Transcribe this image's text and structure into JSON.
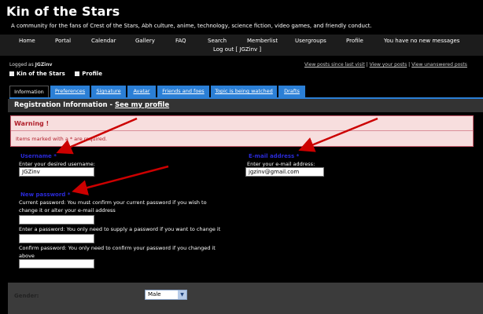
{
  "site": {
    "title": "Kin of the Stars",
    "description": "A community for the fans of Crest of the Stars, Abh culture, anime, technology, science fiction, video games, and friendly conduct."
  },
  "nav": {
    "home": "Home",
    "portal": "Portal",
    "calendar": "Calendar",
    "gallery": "Gallery",
    "faq": "FAQ",
    "search": "Search",
    "memberlist": "Memberlist",
    "usergroups": "Usergroups",
    "profile": "Profile",
    "messages": "You have no new messages",
    "logout": "Log out [ JGZinv ]"
  },
  "userbar": {
    "logged_as_prefix": "Logged as",
    "logged_as_user": "JGZinv",
    "posts_since_last_visit": "View posts since last visit",
    "your_posts": "View your posts",
    "unanswered_posts": "View unanswered posts",
    "separator": "|"
  },
  "breadcrumb": {
    "home": "Kin of the Stars",
    "profile": "Profile"
  },
  "tabs": {
    "information": "Information",
    "preferences": "Preferences",
    "signature": "Signature",
    "avatar": "Avatar",
    "friends": "Friends and foes",
    "watched": "Topic is being watched",
    "drafts": "Drafts"
  },
  "section": {
    "title": "Registration Information - ",
    "link": "See my profile"
  },
  "warning": {
    "title": "Warning !",
    "text": "Items marked with a * are required."
  },
  "form": {
    "username": {
      "label": "Username *",
      "help": "Enter your desired username:",
      "value": "JGZinv"
    },
    "email": {
      "label": "E-mail address *",
      "help": "Enter your e-mail address:",
      "value": "jgzinv@gmail.com"
    },
    "password": {
      "label": "New password *",
      "current_help": "Current password: You must confirm your current password if you wish to change it or alter your e-mail address",
      "new_help": "Enter a password: You only need to supply a password if you want to change it",
      "confirm_help": "Confirm password: You only need to confirm your password if you changed it above",
      "current_value": "",
      "new_value": "",
      "confirm_value": ""
    },
    "gender": {
      "label": "Gender:",
      "value": "Male"
    }
  },
  "colors": {
    "accent_blue": "#2b7fd6",
    "arrow_red": "#cc0000",
    "warning_bg": "#f7dede",
    "warning_text": "#b01e2a",
    "field_label": "#2a2ad8"
  }
}
